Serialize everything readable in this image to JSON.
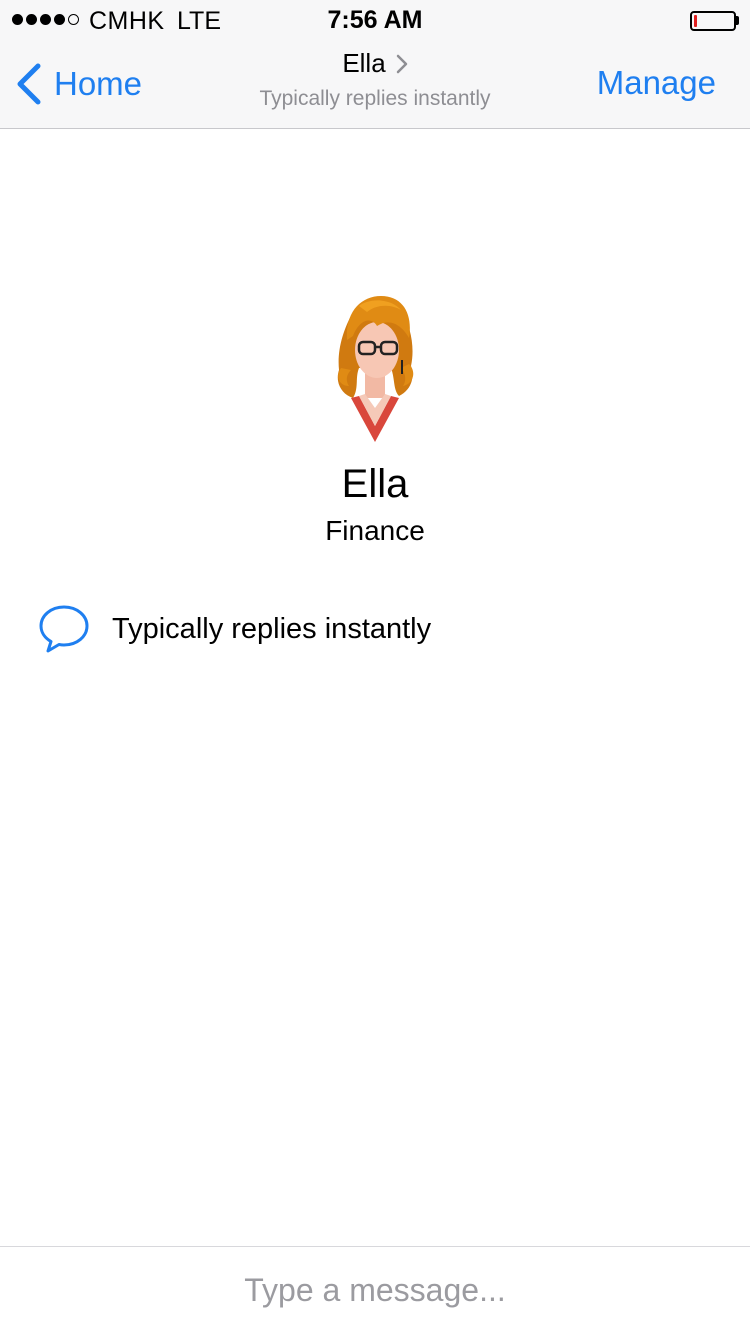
{
  "status_bar": {
    "carrier": "CMHK",
    "network": "LTE",
    "time": "7:56 AM",
    "signal_bars_filled": 4,
    "signal_bars_total": 5,
    "battery_level_fraction": 0.08,
    "battery_color": "#e02020"
  },
  "nav": {
    "back_label": "Home",
    "title": "Ella",
    "subtitle": "Typically replies instantly",
    "manage_label": "Manage",
    "accent_color": "#1f7ff0"
  },
  "profile": {
    "name": "Ella",
    "department": "Finance",
    "avatar_icon": "woman-with-glasses-avatar"
  },
  "reply_info": {
    "icon": "speech-bubble-icon",
    "text": "Typically replies instantly"
  },
  "composer": {
    "placeholder": "Type a message..."
  }
}
